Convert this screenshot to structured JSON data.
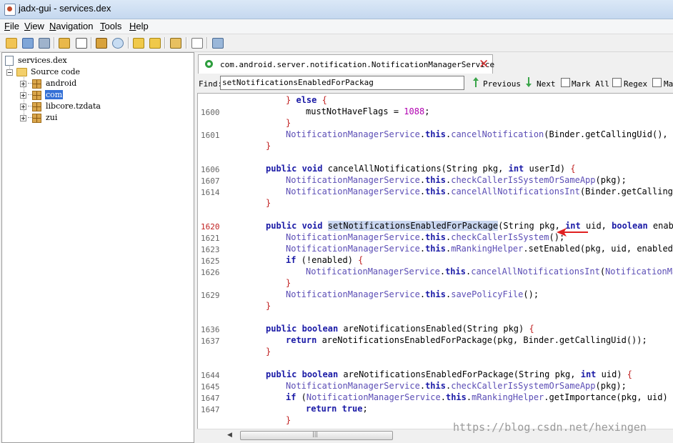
{
  "window": {
    "title": "jadx-gui - services.dex"
  },
  "menu": {
    "items": [
      "File",
      "View",
      "Navigation",
      "Tools",
      "Help"
    ]
  },
  "tree": {
    "root": "services.dex",
    "source": "Source code",
    "packages": [
      "android",
      "com",
      "libcore.tzdata",
      "zui"
    ],
    "selected": "com"
  },
  "tab": {
    "label": "com.android.server.notification.NotificationManagerService"
  },
  "find": {
    "label": "Find:",
    "value": "setNotificationsEnabledForPackag",
    "previous": "Previous",
    "next": "Next",
    "mark_all": "Mark All",
    "regex": "Regex",
    "more": "Ma"
  },
  "code": {
    "lines": [
      {
        "ln": "",
        "text": "} else {"
      },
      {
        "ln": "1600",
        "text": "mustNotHaveFlags = 1088;"
      },
      {
        "ln": "",
        "text": "}"
      },
      {
        "ln": "1601",
        "text": "NotificationManagerService.this.cancelNotification(Binder.getCallingUid(), Bin"
      },
      {
        "ln": "",
        "text": "}"
      },
      {
        "ln": "1606",
        "text": "public void cancelAllNotifications(String pkg, int userId) {"
      },
      {
        "ln": "1607",
        "text": "NotificationManagerService.this.checkCallerIsSystemOrSameApp(pkg);"
      },
      {
        "ln": "1614",
        "text": "NotificationManagerService.this.cancelAllNotificationsInt(Binder.getCallingUic"
      },
      {
        "ln": "",
        "text": "}"
      },
      {
        "ln": "1620",
        "text": "public void setNotificationsEnabledForPackage(String pkg, int uid, boolean enable"
      },
      {
        "ln": "1621",
        "text": "NotificationManagerService.this.checkCallerIsSystem();"
      },
      {
        "ln": "1623",
        "text": "NotificationManagerService.this.mRankingHelper.setEnabled(pkg, uid, enabled);"
      },
      {
        "ln": "1625",
        "text": "if (!enabled) {"
      },
      {
        "ln": "1626",
        "text": "NotificationManagerService.this.cancelAllNotificationsInt(NotificationMana"
      },
      {
        "ln": "",
        "text": "}"
      },
      {
        "ln": "1629",
        "text": "NotificationManagerService.this.savePolicyFile();"
      },
      {
        "ln": "",
        "text": "}"
      },
      {
        "ln": "1636",
        "text": "public boolean areNotificationsEnabled(String pkg) {"
      },
      {
        "ln": "1637",
        "text": "return areNotificationsEnabledForPackage(pkg, Binder.getCallingUid());"
      },
      {
        "ln": "",
        "text": "}"
      },
      {
        "ln": "1644",
        "text": "public boolean areNotificationsEnabledForPackage(String pkg, int uid) {"
      },
      {
        "ln": "1645",
        "text": "NotificationManagerService.this.checkCallerIsSystemOrSameApp(pkg);"
      },
      {
        "ln": "1647",
        "text": "if (NotificationManagerService.this.mRankingHelper.getImportance(pkg, uid) !="
      },
      {
        "ln": "1647",
        "text": "return true;"
      },
      {
        "ln": "",
        "text": "}"
      }
    ],
    "current_line": "1620",
    "highlight": "setNotificationsEnabledForPackage"
  },
  "watermark": "https://blog.csdn.net/hexingen",
  "colors": {
    "keyword": "#1a1aa6",
    "class": "#5b4db5",
    "brace": "#c02020",
    "number": "#b000b0",
    "selection": "#3470d6",
    "annotation_arrow": "#e02020"
  }
}
